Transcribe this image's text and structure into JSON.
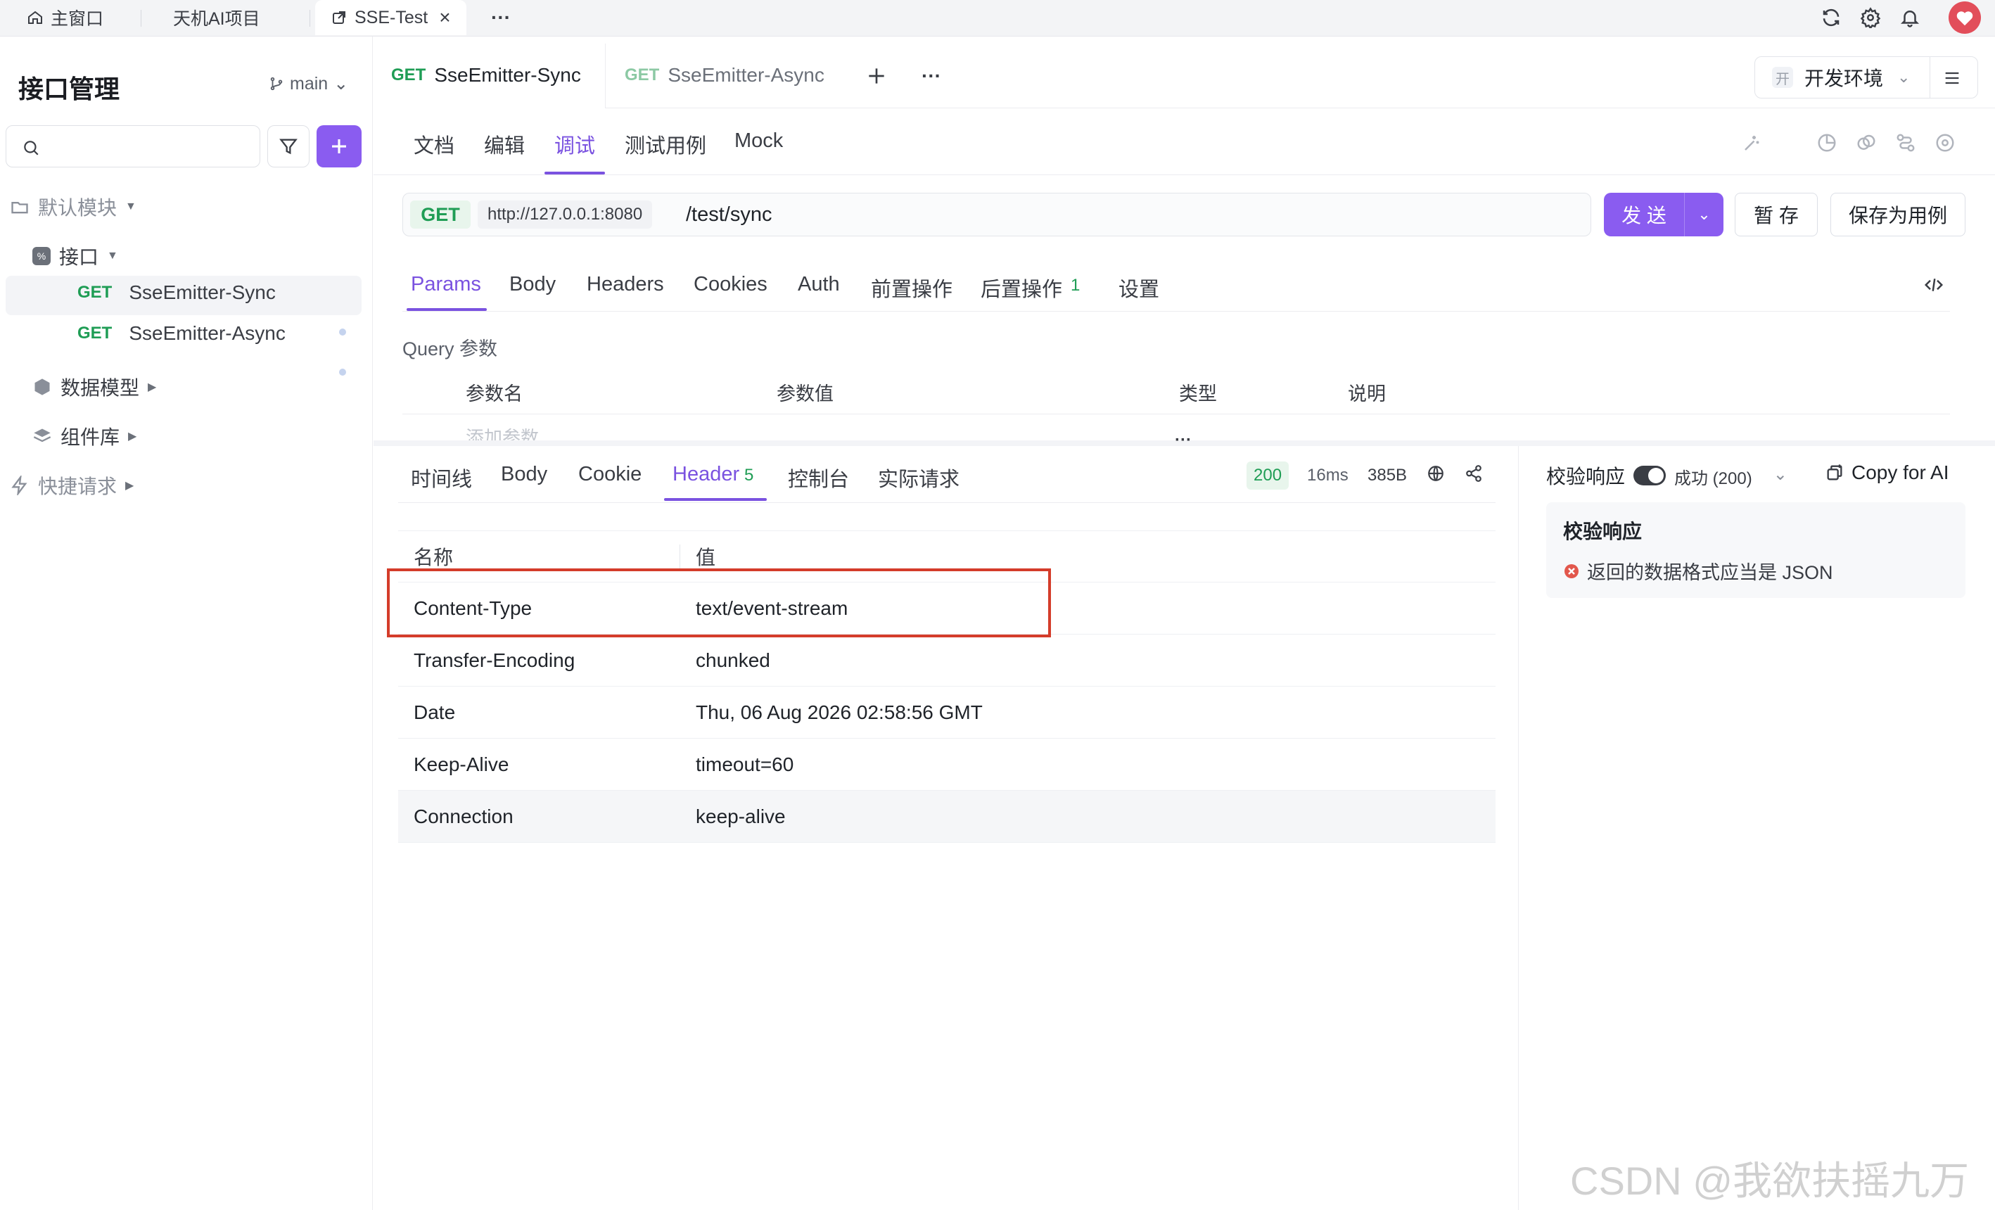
{
  "window_tabs": [
    {
      "label": "主窗口",
      "icon": "home-icon"
    },
    {
      "label": "天机AI项目"
    },
    {
      "label": "SSE-Test",
      "icon": "external-link-icon",
      "close": "×"
    }
  ],
  "window_more": "···",
  "sidebar": {
    "title": "接口管理",
    "branch": "main",
    "tree": {
      "default_module": "默认模块",
      "api_folder": "接口",
      "items": [
        {
          "method": "GET",
          "name": "SseEmitter-Sync"
        },
        {
          "method": "GET",
          "name": "SseEmitter-Async"
        }
      ],
      "data_model": "数据模型",
      "components": "组件库",
      "quick_request": "快捷请求"
    }
  },
  "api_tabs": [
    {
      "method": "GET",
      "name": "SseEmitter-Sync"
    },
    {
      "method": "GET",
      "name": "SseEmitter-Async"
    }
  ],
  "env": {
    "badge": "开",
    "label": "开发环境"
  },
  "mode_tabs": [
    "文档",
    "编辑",
    "调试",
    "测试用例",
    "Mock"
  ],
  "request": {
    "method": "GET",
    "base_url": "http://127.0.0.1:8080",
    "path": "/test/sync",
    "send": "发 送",
    "save_temp": "暂 存",
    "save_case": "保存为用例"
  },
  "param_tabs": [
    "Params",
    "Body",
    "Headers",
    "Cookies",
    "Auth",
    "前置操作",
    "后置操作",
    "设置"
  ],
  "post_ops_count": "1",
  "query": {
    "title": "Query 参数",
    "columns": [
      "参数名",
      "参数值",
      "类型",
      "说明"
    ],
    "add_placeholder": "添加参数"
  },
  "divider_handle": "···",
  "response": {
    "tabs": [
      "时间线",
      "Body",
      "Cookie",
      "Header",
      "控制台",
      "实际请求"
    ],
    "header_count": "5",
    "status": "200",
    "time": "16ms",
    "size": "385B",
    "columns": [
      "名称",
      "值"
    ],
    "headers": [
      {
        "name": "Content-Type",
        "value": "text/event-stream"
      },
      {
        "name": "Transfer-Encoding",
        "value": "chunked"
      },
      {
        "name": "Date",
        "value": "Thu, 06 Aug 2026 02:58:56 GMT"
      },
      {
        "name": "Keep-Alive",
        "value": "timeout=60"
      },
      {
        "name": "Connection",
        "value": "keep-alive"
      }
    ]
  },
  "validation": {
    "toggle_label": "校验响应",
    "result_select": "成功 (200)",
    "copy_ai": "Copy for AI",
    "panel_title": "校验响应",
    "error_message": "返回的数据格式应当是 JSON"
  },
  "watermark": "CSDN @我欲扶摇九万里",
  "colors": {
    "accent": "#7a52e0",
    "get": "#1f9d55",
    "highlight_box": "#d43c2a",
    "error": "#e2574c"
  }
}
